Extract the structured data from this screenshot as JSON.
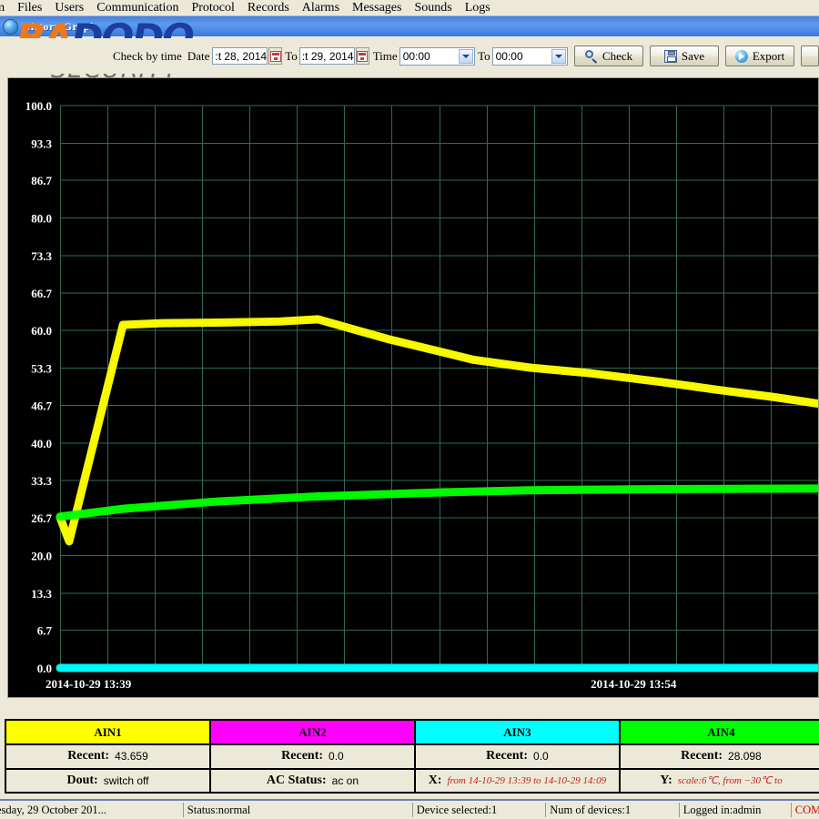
{
  "menubar": {
    "items": [
      {
        "label": "em"
      },
      {
        "label": "Files"
      },
      {
        "label": "Users"
      },
      {
        "label": "Communication"
      },
      {
        "label": "Protocol"
      },
      {
        "label": "Records"
      },
      {
        "label": "Alarms"
      },
      {
        "label": "Messages"
      },
      {
        "label": "Sounds"
      },
      {
        "label": "Logs"
      }
    ]
  },
  "window": {
    "title": "History Graph",
    "icon": "globe-icon"
  },
  "logo": {
    "part1": "BA",
    "part2": "DODO",
    "subtitle": "SECURITY",
    "color1": "#f07818",
    "color2": "#1a3fa0"
  },
  "toolbar": {
    "check_by_time_label": "Check by time",
    "date_label": "Date",
    "date_from_value": ":t 28,  2014",
    "to_label_1": "To",
    "date_to_value": ":t 29,  2014",
    "time_label": "Time",
    "time_from_value": "00:00",
    "to_label_2": "To",
    "time_to_value": "00:00",
    "check_button": "Check",
    "save_button": "Save",
    "export_button": "Export",
    "calendar_icon": "calendar-icon",
    "search_icon": "search-icon",
    "save_icon": "floppy-disk-icon",
    "export_icon": "export-icon",
    "dropdown_icon": "chevron-down-icon"
  },
  "chart_data": {
    "type": "line",
    "title": "",
    "xlabel": "",
    "ylabel": "",
    "ylim": [
      0.0,
      100.0
    ],
    "ytick_labels": [
      "100.0",
      "93.3",
      "86.7",
      "80.0",
      "73.3",
      "66.7",
      "60.0",
      "53.3",
      "46.7",
      "40.0",
      "33.3",
      "26.7",
      "20.0",
      "13.3",
      "6.7",
      "0.0"
    ],
    "ytick_values": [
      100.0,
      93.3,
      86.7,
      80.0,
      73.3,
      66.7,
      60.0,
      53.3,
      46.7,
      40.0,
      33.3,
      26.7,
      20.0,
      13.3,
      6.7,
      0.0
    ],
    "x_axis_start_label": "2014-10-29 13:39",
    "x_axis_end_label": "2014-10-29 13:54",
    "x_gridlines": 16,
    "grid": true,
    "grid_color": "#2f6b4f",
    "background": "#000000",
    "legend_position": "bottom",
    "series": [
      {
        "name": "AIN1",
        "color": "#ffff00",
        "x": [
          0.0,
          0.012,
          0.083,
          0.135,
          0.208,
          0.289,
          0.34,
          0.432,
          0.5,
          0.545,
          0.62,
          0.7,
          0.79,
          0.87,
          0.94,
          1.0
        ],
        "values": [
          26.8,
          22.5,
          61.0,
          61.3,
          61.4,
          61.6,
          62.0,
          58.5,
          56.3,
          54.8,
          53.4,
          52.4,
          50.9,
          49.4,
          48.2,
          47.0
        ]
      },
      {
        "name": "AIN2",
        "color": "#ff00ff",
        "x": [],
        "values": []
      },
      {
        "name": "AIN3",
        "color": "#00ffff",
        "x": [
          0.0,
          1.0
        ],
        "values": [
          0.0,
          0.0
        ]
      },
      {
        "name": "AIN4",
        "color": "#00ff00",
        "x": [
          0.0,
          0.083,
          0.208,
          0.34,
          0.5,
          0.62,
          0.79,
          1.0
        ],
        "values": [
          26.9,
          28.3,
          29.6,
          30.5,
          31.2,
          31.6,
          31.8,
          31.9
        ]
      }
    ]
  },
  "legend": [
    {
      "name": "AIN1",
      "color": "#ffff00",
      "row2_label": "Recent:",
      "row2_value": "43.659",
      "row3_label": "Dout:",
      "row3_value": "switch off",
      "row3_red": false
    },
    {
      "name": "AIN2",
      "color": "#ff00ff",
      "row2_label": "Recent:",
      "row2_value": "0.0",
      "row3_label": "AC Status:",
      "row3_value": "ac on",
      "row3_red": false
    },
    {
      "name": "AIN3",
      "color": "#00ffff",
      "row2_label": "Recent:",
      "row2_value": "0.0",
      "row3_label": "X:",
      "row3_value": "from 14-10-29 13:39 to 14-10-29 14:09",
      "row3_red": true
    },
    {
      "name": "AIN4",
      "color": "#00ff00",
      "row2_label": "Recent:",
      "row2_value": "28.098",
      "row3_label": "Y:",
      "row3_value": "scale:6℃, from −30℃ to",
      "row3_red": true
    }
  ],
  "statusbar": {
    "date": "esday, 29 October 201...",
    "status": "Status:normal",
    "device_selected": "Device selected:1",
    "num_devices": "Num of devices:1",
    "logged_in": "Logged in:admin",
    "com": "COM"
  }
}
